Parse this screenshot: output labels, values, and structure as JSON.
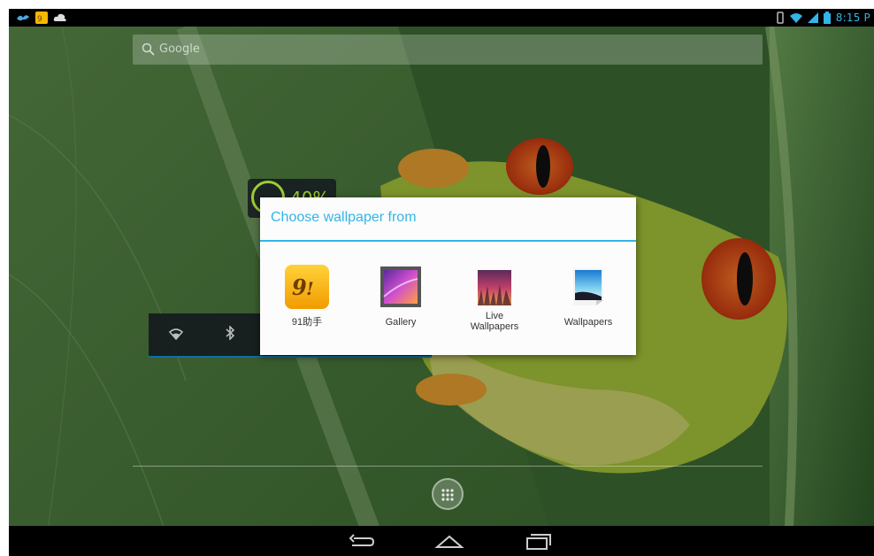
{
  "status_bar": {
    "time": "8:15 P",
    "left_icons": [
      "bird-app-icon",
      "91-app-icon",
      "cloud-icon"
    ],
    "right_icons": [
      "vibrate-icon",
      "wifi-icon",
      "signal-icon",
      "battery-icon"
    ]
  },
  "search": {
    "label": "Google"
  },
  "widgets": {
    "battery_percent": "40%",
    "power_control_icons": [
      "wifi-icon",
      "bluetooth-icon"
    ]
  },
  "dialog": {
    "title": "Choose wallpaper from",
    "options": [
      {
        "label": "91助手",
        "icon": "91-assistant-icon"
      },
      {
        "label": "Gallery",
        "icon": "gallery-icon"
      },
      {
        "label_line1": "Live",
        "label_line2": "Wallpapers",
        "icon": "live-wallpapers-icon"
      },
      {
        "label": "Wallpapers",
        "icon": "wallpapers-icon"
      }
    ]
  },
  "navigation": {
    "buttons": [
      "back-icon",
      "home-icon",
      "recent-apps-icon"
    ]
  },
  "colors": {
    "accent": "#33b5e5",
    "status_bar_bg": "#000000",
    "dialog_bg": "#fcfcfc"
  }
}
